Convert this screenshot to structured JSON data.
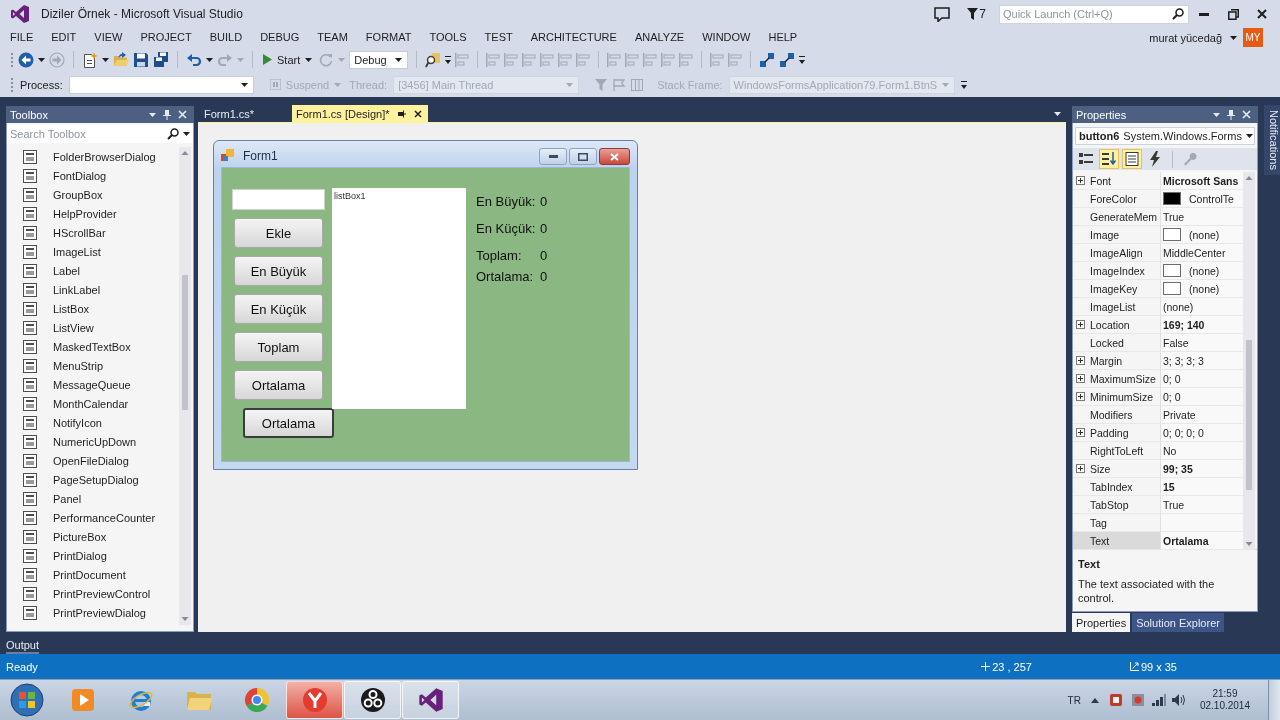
{
  "window": {
    "title": "Diziler Örnek - Microsoft Visual Studio",
    "notification_count": "7",
    "quick_launch": {
      "placeholder": "Quick Launch (Ctrl+Q)"
    },
    "user": {
      "name": "murat yücedağ",
      "initials": "MY"
    }
  },
  "menu": [
    "FILE",
    "EDIT",
    "VIEW",
    "PROJECT",
    "BUILD",
    "DEBUG",
    "TEAM",
    "FORMAT",
    "TOOLS",
    "TEST",
    "ARCHITECTURE",
    "ANALYZE",
    "WINDOW",
    "HELP"
  ],
  "toolbar": {
    "groups": [
      [
        {
          "kind": "back",
          "disabled": false
        },
        {
          "kind": "forward",
          "disabled": true
        }
      ],
      [
        {
          "kind": "new",
          "disabled": false
        },
        {
          "kind": "open",
          "disabled": false
        },
        {
          "kind": "save",
          "disabled": false
        },
        {
          "kind": "saveall",
          "disabled": false
        }
      ],
      [
        {
          "kind": "undo",
          "disabled": false
        },
        {
          "kind": "redo",
          "disabled": true
        }
      ],
      [
        {
          "kind": "start",
          "label": "Start",
          "disabled": false
        },
        {
          "kind": "restart",
          "disabled": true
        },
        {
          "kind": "config",
          "value": "Debug",
          "disabled": false
        }
      ],
      [
        {
          "kind": "find",
          "disabled": false
        },
        {
          "kind": "align",
          "disabled": true
        }
      ],
      [
        {
          "kind": "align",
          "disabled": true
        },
        {
          "kind": "align",
          "disabled": true
        },
        {
          "kind": "align",
          "disabled": true
        },
        {
          "kind": "align",
          "disabled": true
        },
        {
          "kind": "align",
          "disabled": true
        },
        {
          "kind": "align",
          "disabled": true
        }
      ],
      [
        {
          "kind": "align",
          "disabled": true
        },
        {
          "kind": "align",
          "disabled": true
        },
        {
          "kind": "align",
          "disabled": true
        },
        {
          "kind": "align",
          "disabled": true
        },
        {
          "kind": "align",
          "disabled": true
        }
      ],
      [
        {
          "kind": "align",
          "disabled": true
        },
        {
          "kind": "align",
          "disabled": true
        }
      ],
      [
        {
          "kind": "connect",
          "disabled": false
        },
        {
          "kind": "connect",
          "disabled": false
        }
      ]
    ]
  },
  "debug_toolbar": {
    "process": {
      "label": "Process:",
      "disabled": false
    },
    "suspend": {
      "label": "Suspend",
      "disabled": true
    },
    "thread": {
      "label": "Thread:",
      "value": "[3456] Main Thread",
      "disabled": true
    },
    "tools": [
      {
        "kind": "filter",
        "disabled": true
      },
      {
        "kind": "flag",
        "disabled": true
      },
      {
        "kind": "columns",
        "disabled": true
      }
    ],
    "stack_frame": {
      "label": "Stack Frame:",
      "value": "WindowsFormsApplication79.Form1.BtnS",
      "disabled": true
    }
  },
  "toolbox": {
    "title": "Toolbox",
    "search": {
      "placeholder": "Search Toolbox"
    },
    "items": [
      "FolderBrowserDialog",
      "FontDialog",
      "GroupBox",
      "HelpProvider",
      "HScrollBar",
      "ImageList",
      "Label",
      "LinkLabel",
      "ListBox",
      "ListView",
      "MaskedTextBox",
      "MenuStrip",
      "MessageQueue",
      "MonthCalendar",
      "NotifyIcon",
      "NumericUpDown",
      "OpenFileDialog",
      "PageSetupDialog",
      "Panel",
      "PerformanceCounter",
      "PictureBox",
      "PrintDialog",
      "PrintDocument",
      "PrintPreviewControl",
      "PrintPreviewDialog"
    ]
  },
  "document_tabs": [
    {
      "label": "Form1.cs*",
      "selected": false
    },
    {
      "label": "Form1.cs [Design]*",
      "selected": true
    }
  ],
  "form": {
    "title": "Form1",
    "buttons": [
      {
        "label": "Ekle",
        "selected": false
      },
      {
        "label": "En Büyük",
        "selected": false
      },
      {
        "label": "En Küçük",
        "selected": false
      },
      {
        "label": "Toplam",
        "selected": false
      },
      {
        "label": "Ortalama",
        "selected": false
      },
      {
        "label": "Ortalama",
        "selected": true
      }
    ],
    "listbox": {
      "label": "listBox1"
    },
    "labels": [
      {
        "name": "En Büyük:",
        "value": "0"
      },
      {
        "name": "En Küçük:",
        "value": "0"
      },
      {
        "name": "Toplam:",
        "value": "0"
      },
      {
        "name": "Ortalama:",
        "value": "0"
      }
    ]
  },
  "properties": {
    "title": "Properties",
    "selector": {
      "name": "button6",
      "type": "System.Windows.Forms"
    },
    "toolbar": [
      {
        "kind": "categorized",
        "selected": false,
        "disabled": false
      },
      {
        "kind": "alphabetical",
        "selected": true,
        "disabled": false
      },
      {
        "kind": "properties",
        "selected": true,
        "disabled": false
      },
      {
        "kind": "events",
        "selected": false,
        "disabled": false
      },
      {
        "kind": "pages",
        "selected": false,
        "disabled": true
      }
    ],
    "rows": [
      {
        "name": "Font",
        "value": "Microsoft Sans",
        "expandable": true,
        "bold": true,
        "selected": false
      },
      {
        "name": "ForeColor",
        "value": "ControlTe",
        "color": "#000000",
        "expandable": false,
        "bold": false,
        "selected": false
      },
      {
        "name": "GenerateMem",
        "value": "True",
        "expandable": false,
        "bold": false,
        "selected": false
      },
      {
        "name": "Image",
        "value": "(none)",
        "color": "#ffffff",
        "expandable": false,
        "bold": false,
        "selected": false
      },
      {
        "name": "ImageAlign",
        "value": "MiddleCenter",
        "expandable": false,
        "bold": false,
        "selected": false
      },
      {
        "name": "ImageIndex",
        "value": "(none)",
        "color": "#ffffff",
        "expandable": false,
        "bold": false,
        "selected": false
      },
      {
        "name": "ImageKey",
        "value": "(none)",
        "color": "#ffffff",
        "expandable": false,
        "bold": false,
        "selected": false
      },
      {
        "name": "ImageList",
        "value": "(none)",
        "expandable": false,
        "bold": false,
        "selected": false
      },
      {
        "name": "Location",
        "value": "169; 140",
        "expandable": true,
        "bold": true,
        "selected": false
      },
      {
        "name": "Locked",
        "value": "False",
        "expandable": false,
        "bold": false,
        "selected": false
      },
      {
        "name": "Margin",
        "value": "3; 3; 3; 3",
        "expandable": true,
        "bold": false,
        "selected": false
      },
      {
        "name": "MaximumSize",
        "value": "0; 0",
        "expandable": true,
        "bold": false,
        "selected": false
      },
      {
        "name": "MinimumSize",
        "value": "0; 0",
        "expandable": true,
        "bold": false,
        "selected": false
      },
      {
        "name": "Modifiers",
        "value": "Private",
        "expandable": false,
        "bold": false,
        "selected": false
      },
      {
        "name": "Padding",
        "value": "0; 0; 0; 0",
        "expandable": true,
        "bold": false,
        "selected": false
      },
      {
        "name": "RightToLeft",
        "value": "No",
        "expandable": false,
        "bold": false,
        "selected": false
      },
      {
        "name": "Size",
        "value": "99; 35",
        "expandable": true,
        "bold": true,
        "selected": false
      },
      {
        "name": "TabIndex",
        "value": "15",
        "expandable": false,
        "bold": true,
        "selected": false
      },
      {
        "name": "TabStop",
        "value": "True",
        "expandable": false,
        "bold": false,
        "selected": false
      },
      {
        "name": "Tag",
        "expandable": false,
        "selected": false
      },
      {
        "name": "Text",
        "value": "Ortalama",
        "expandable": false,
        "bold": true,
        "selected": true
      }
    ],
    "description": {
      "title": "Text",
      "text": "The text associated with the control."
    },
    "tabs": [
      {
        "label": "Properties",
        "selected": true
      },
      {
        "label": "Solution Explorer",
        "selected": false
      }
    ]
  },
  "notifications_tab": "Notifications",
  "output_tab": "Output",
  "status_bar": {
    "text": "Ready",
    "position": "23 , 257",
    "size": "99 x 35"
  },
  "taskbar": {
    "apps": [
      {
        "kind": "media",
        "running": false,
        "highlighted": false
      },
      {
        "kind": "ie",
        "running": false,
        "highlighted": false
      },
      {
        "kind": "explorer",
        "running": false,
        "highlighted": false
      },
      {
        "kind": "chrome",
        "running": false,
        "highlighted": false
      },
      {
        "kind": "yandex",
        "running": true,
        "highlighted": true
      },
      {
        "kind": "obs",
        "running": true,
        "highlighted": false
      },
      {
        "kind": "vs",
        "running": true,
        "highlighted": false
      }
    ],
    "language": "TR",
    "time": "21:59",
    "date": "02.10.2014"
  }
}
